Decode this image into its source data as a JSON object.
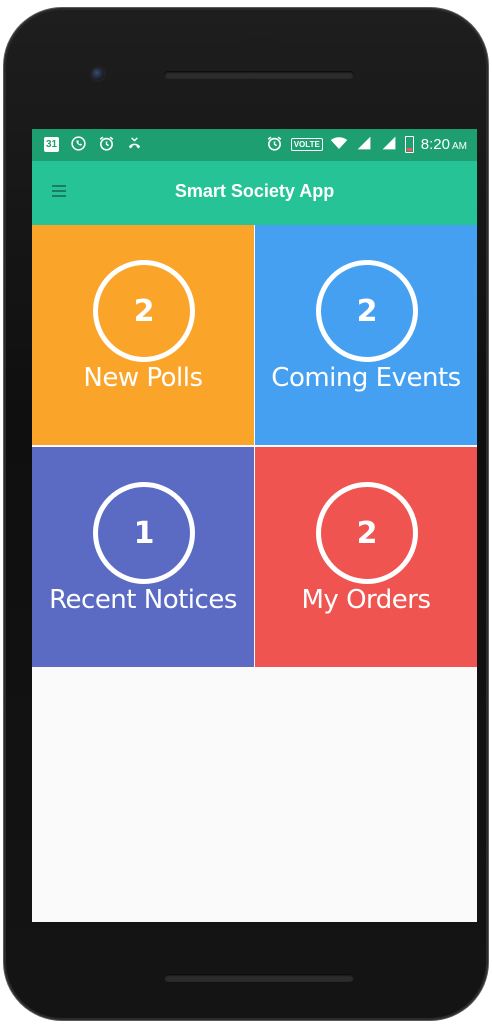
{
  "status_bar": {
    "calendar_day": "31",
    "volte": "VOLTE",
    "time": "8:20",
    "ampm": "AM",
    "icons_left": [
      "calendar-icon",
      "whatsapp-icon",
      "alarm-icon",
      "missed-call-icon"
    ],
    "icons_right": [
      "alarm-icon",
      "volte-icon",
      "wifi-icon",
      "signal-icon",
      "signal-icon",
      "battery-icon"
    ]
  },
  "app_bar": {
    "title": "Smart Society App",
    "menu_icon": "hamburger-menu-icon"
  },
  "tiles": [
    {
      "count": "2",
      "label": "New Polls",
      "color": "#fba42a"
    },
    {
      "count": "2",
      "label": "Coming Events",
      "color": "#45a0f2"
    },
    {
      "count": "1",
      "label": "Recent Notices",
      "color": "#5b6bc3"
    },
    {
      "count": "2",
      "label": "My Orders",
      "color": "#ef5451"
    }
  ],
  "colors": {
    "status_bar": "#1e9f72",
    "app_bar": "#25c395"
  }
}
